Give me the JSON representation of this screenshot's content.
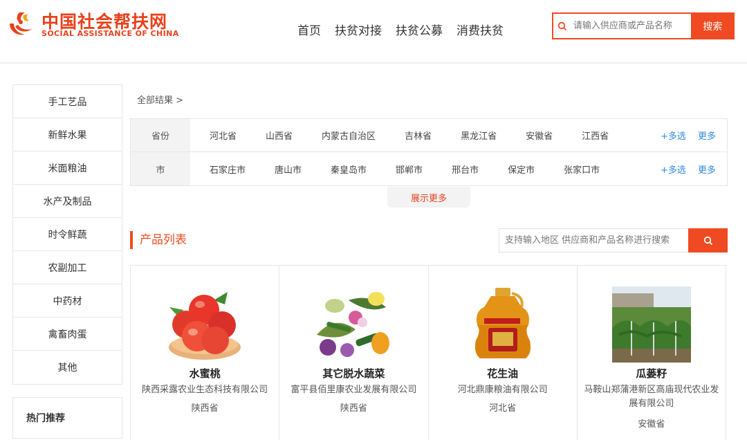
{
  "brand": {
    "name_cn": "中国社会帮扶网",
    "name_en": "SOCIAL ASSISTANCE OF CHINA",
    "color": "#e8411b"
  },
  "nav": [
    "首页",
    "扶贫对接",
    "扶贫公募",
    "消费扶贫"
  ],
  "top_search": {
    "placeholder": "请输入供应商或产品名称",
    "button": "搜索"
  },
  "categories": [
    "手工艺品",
    "新鲜水果",
    "米面粮油",
    "水产及制品",
    "时令鲜蔬",
    "农副加工",
    "中药材",
    "禽畜肉蛋",
    "其他"
  ],
  "hot_title": "热门推荐",
  "breadcrumb": "全部结果 >",
  "filters": {
    "province": {
      "label": "省份",
      "options": [
        "河北省",
        "山西省",
        "内蒙古自治区",
        "吉林省",
        "黑龙江省",
        "安徽省",
        "江西省"
      ]
    },
    "city": {
      "label": "市",
      "options": [
        "石家庄市",
        "唐山市",
        "秦皇岛市",
        "邯郸市",
        "邢台市",
        "保定市",
        "张家口市"
      ]
    },
    "multi_label": "+多选",
    "more_label": "更多",
    "show_more": "展示更多"
  },
  "products_title": "产品列表",
  "product_search": {
    "placeholder": "支持输入地区 供应商和产品名称进行搜索"
  },
  "products": [
    {
      "name": "水蜜桃",
      "company": "陕西采露农业生态科技有限公司",
      "province": "陕西省"
    },
    {
      "name": "其它脱水蔬菜",
      "company": "富平县佰里康农业发展有限公司",
      "province": "陕西省"
    },
    {
      "name": "花生油",
      "company": "河北鼎康粮油有限公司",
      "province": "河北省"
    },
    {
      "name": "瓜蒌籽",
      "company": "马鞍山郑蒲港新区高庙现代农业发展有限公司",
      "province": "安徽省"
    }
  ]
}
